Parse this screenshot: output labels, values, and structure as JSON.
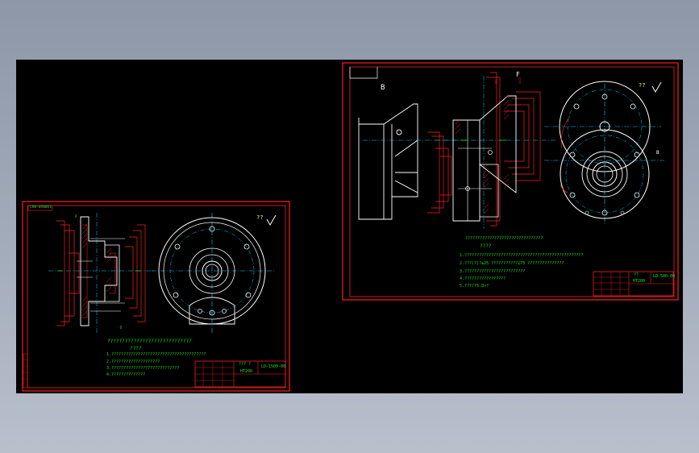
{
  "colors": {
    "background_top": "#8d97a8",
    "background_bottom": "#b9c0cc",
    "canvas": "#000000",
    "frame": "#ff1f1f",
    "centerline": "#00d2ff",
    "geometry": "#ffffff",
    "hatch": "#ff1f1f",
    "text": "#19e619"
  },
  "sheet1": {
    "code_block": "CR8-050051",
    "roughness": "??",
    "tech_title": "?????????????????????????????",
    "tech_subtitle": "????",
    "notes": [
      "1.???????????????????????????????????????",
      "2.????????????????????",
      "3.????????????????????????????",
      "4.??????????????"
    ],
    "title_block": {
      "name": "??? ?",
      "code": "LD-1500-00",
      "material": "HT200"
    }
  },
  "sheet2": {
    "roughness": "??",
    "section_mark": "B",
    "view_mark_f": "F",
    "view_mark_b": "B",
    "tech_title": "????????????????????????????????",
    "tech_subtitle": "????",
    "notes": [
      "1.?????????????????????????????????????????????????",
      "2.???(?)?±25  ???????????175   ???????????????",
      "3.?????????????????????????",
      "4.?????????????????",
      "5.?????5.0×?"
    ],
    "title_block": {
      "name": "??",
      "code": "LD-500-00",
      "material": "HT200"
    }
  }
}
